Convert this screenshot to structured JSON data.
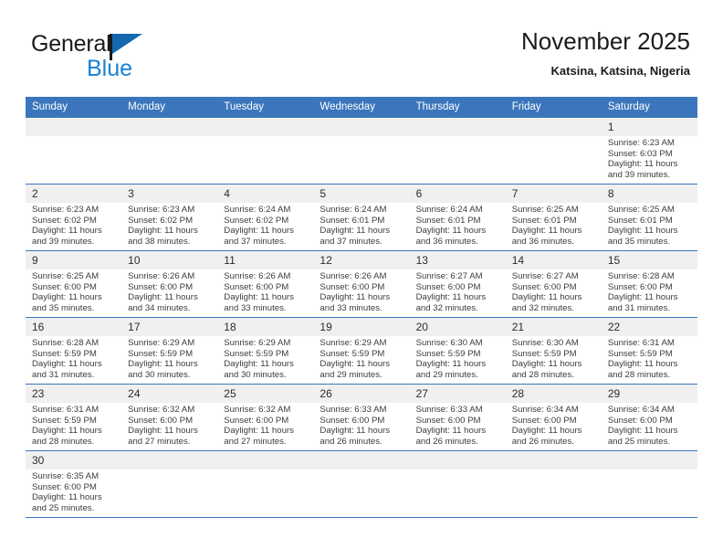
{
  "logo": {
    "text_primary": "General",
    "text_secondary": "Blue",
    "primary_color": "#1b1b1b",
    "secondary_color": "#1a7fd4",
    "flag_color": "#1567b0"
  },
  "header": {
    "title": "November 2025",
    "subtitle": "Katsina, Katsina, Nigeria"
  },
  "theme": {
    "header_bg": "#3b76bc",
    "header_text": "#ffffff",
    "daynum_bg": "#f0f0f0",
    "grid_line": "#3b76bc"
  },
  "calendar": {
    "weekday_headers": [
      "Sunday",
      "Monday",
      "Tuesday",
      "Wednesday",
      "Thursday",
      "Friday",
      "Saturday"
    ],
    "weeks": [
      [
        {
          "blank": true,
          "day": "",
          "sunrise": "",
          "sunset": "",
          "daylight": ""
        },
        {
          "blank": true,
          "day": "",
          "sunrise": "",
          "sunset": "",
          "daylight": ""
        },
        {
          "blank": true,
          "day": "",
          "sunrise": "",
          "sunset": "",
          "daylight": ""
        },
        {
          "blank": true,
          "day": "",
          "sunrise": "",
          "sunset": "",
          "daylight": ""
        },
        {
          "blank": true,
          "day": "",
          "sunrise": "",
          "sunset": "",
          "daylight": ""
        },
        {
          "blank": true,
          "day": "",
          "sunrise": "",
          "sunset": "",
          "daylight": ""
        },
        {
          "blank": false,
          "day": "1",
          "sunrise": "Sunrise: 6:23 AM",
          "sunset": "Sunset: 6:03 PM",
          "daylight": "Daylight: 11 hours and 39 minutes."
        }
      ],
      [
        {
          "blank": false,
          "day": "2",
          "sunrise": "Sunrise: 6:23 AM",
          "sunset": "Sunset: 6:02 PM",
          "daylight": "Daylight: 11 hours and 39 minutes."
        },
        {
          "blank": false,
          "day": "3",
          "sunrise": "Sunrise: 6:23 AM",
          "sunset": "Sunset: 6:02 PM",
          "daylight": "Daylight: 11 hours and 38 minutes."
        },
        {
          "blank": false,
          "day": "4",
          "sunrise": "Sunrise: 6:24 AM",
          "sunset": "Sunset: 6:02 PM",
          "daylight": "Daylight: 11 hours and 37 minutes."
        },
        {
          "blank": false,
          "day": "5",
          "sunrise": "Sunrise: 6:24 AM",
          "sunset": "Sunset: 6:01 PM",
          "daylight": "Daylight: 11 hours and 37 minutes."
        },
        {
          "blank": false,
          "day": "6",
          "sunrise": "Sunrise: 6:24 AM",
          "sunset": "Sunset: 6:01 PM",
          "daylight": "Daylight: 11 hours and 36 minutes."
        },
        {
          "blank": false,
          "day": "7",
          "sunrise": "Sunrise: 6:25 AM",
          "sunset": "Sunset: 6:01 PM",
          "daylight": "Daylight: 11 hours and 36 minutes."
        },
        {
          "blank": false,
          "day": "8",
          "sunrise": "Sunrise: 6:25 AM",
          "sunset": "Sunset: 6:01 PM",
          "daylight": "Daylight: 11 hours and 35 minutes."
        }
      ],
      [
        {
          "blank": false,
          "day": "9",
          "sunrise": "Sunrise: 6:25 AM",
          "sunset": "Sunset: 6:00 PM",
          "daylight": "Daylight: 11 hours and 35 minutes."
        },
        {
          "blank": false,
          "day": "10",
          "sunrise": "Sunrise: 6:26 AM",
          "sunset": "Sunset: 6:00 PM",
          "daylight": "Daylight: 11 hours and 34 minutes."
        },
        {
          "blank": false,
          "day": "11",
          "sunrise": "Sunrise: 6:26 AM",
          "sunset": "Sunset: 6:00 PM",
          "daylight": "Daylight: 11 hours and 33 minutes."
        },
        {
          "blank": false,
          "day": "12",
          "sunrise": "Sunrise: 6:26 AM",
          "sunset": "Sunset: 6:00 PM",
          "daylight": "Daylight: 11 hours and 33 minutes."
        },
        {
          "blank": false,
          "day": "13",
          "sunrise": "Sunrise: 6:27 AM",
          "sunset": "Sunset: 6:00 PM",
          "daylight": "Daylight: 11 hours and 32 minutes."
        },
        {
          "blank": false,
          "day": "14",
          "sunrise": "Sunrise: 6:27 AM",
          "sunset": "Sunset: 6:00 PM",
          "daylight": "Daylight: 11 hours and 32 minutes."
        },
        {
          "blank": false,
          "day": "15",
          "sunrise": "Sunrise: 6:28 AM",
          "sunset": "Sunset: 6:00 PM",
          "daylight": "Daylight: 11 hours and 31 minutes."
        }
      ],
      [
        {
          "blank": false,
          "day": "16",
          "sunrise": "Sunrise: 6:28 AM",
          "sunset": "Sunset: 5:59 PM",
          "daylight": "Daylight: 11 hours and 31 minutes."
        },
        {
          "blank": false,
          "day": "17",
          "sunrise": "Sunrise: 6:29 AM",
          "sunset": "Sunset: 5:59 PM",
          "daylight": "Daylight: 11 hours and 30 minutes."
        },
        {
          "blank": false,
          "day": "18",
          "sunrise": "Sunrise: 6:29 AM",
          "sunset": "Sunset: 5:59 PM",
          "daylight": "Daylight: 11 hours and 30 minutes."
        },
        {
          "blank": false,
          "day": "19",
          "sunrise": "Sunrise: 6:29 AM",
          "sunset": "Sunset: 5:59 PM",
          "daylight": "Daylight: 11 hours and 29 minutes."
        },
        {
          "blank": false,
          "day": "20",
          "sunrise": "Sunrise: 6:30 AM",
          "sunset": "Sunset: 5:59 PM",
          "daylight": "Daylight: 11 hours and 29 minutes."
        },
        {
          "blank": false,
          "day": "21",
          "sunrise": "Sunrise: 6:30 AM",
          "sunset": "Sunset: 5:59 PM",
          "daylight": "Daylight: 11 hours and 28 minutes."
        },
        {
          "blank": false,
          "day": "22",
          "sunrise": "Sunrise: 6:31 AM",
          "sunset": "Sunset: 5:59 PM",
          "daylight": "Daylight: 11 hours and 28 minutes."
        }
      ],
      [
        {
          "blank": false,
          "day": "23",
          "sunrise": "Sunrise: 6:31 AM",
          "sunset": "Sunset: 5:59 PM",
          "daylight": "Daylight: 11 hours and 28 minutes."
        },
        {
          "blank": false,
          "day": "24",
          "sunrise": "Sunrise: 6:32 AM",
          "sunset": "Sunset: 6:00 PM",
          "daylight": "Daylight: 11 hours and 27 minutes."
        },
        {
          "blank": false,
          "day": "25",
          "sunrise": "Sunrise: 6:32 AM",
          "sunset": "Sunset: 6:00 PM",
          "daylight": "Daylight: 11 hours and 27 minutes."
        },
        {
          "blank": false,
          "day": "26",
          "sunrise": "Sunrise: 6:33 AM",
          "sunset": "Sunset: 6:00 PM",
          "daylight": "Daylight: 11 hours and 26 minutes."
        },
        {
          "blank": false,
          "day": "27",
          "sunrise": "Sunrise: 6:33 AM",
          "sunset": "Sunset: 6:00 PM",
          "daylight": "Daylight: 11 hours and 26 minutes."
        },
        {
          "blank": false,
          "day": "28",
          "sunrise": "Sunrise: 6:34 AM",
          "sunset": "Sunset: 6:00 PM",
          "daylight": "Daylight: 11 hours and 26 minutes."
        },
        {
          "blank": false,
          "day": "29",
          "sunrise": "Sunrise: 6:34 AM",
          "sunset": "Sunset: 6:00 PM",
          "daylight": "Daylight: 11 hours and 25 minutes."
        }
      ],
      [
        {
          "blank": false,
          "day": "30",
          "sunrise": "Sunrise: 6:35 AM",
          "sunset": "Sunset: 6:00 PM",
          "daylight": "Daylight: 11 hours and 25 minutes."
        },
        {
          "blank": true,
          "day": "",
          "sunrise": "",
          "sunset": "",
          "daylight": ""
        },
        {
          "blank": true,
          "day": "",
          "sunrise": "",
          "sunset": "",
          "daylight": ""
        },
        {
          "blank": true,
          "day": "",
          "sunrise": "",
          "sunset": "",
          "daylight": ""
        },
        {
          "blank": true,
          "day": "",
          "sunrise": "",
          "sunset": "",
          "daylight": ""
        },
        {
          "blank": true,
          "day": "",
          "sunrise": "",
          "sunset": "",
          "daylight": ""
        },
        {
          "blank": true,
          "day": "",
          "sunrise": "",
          "sunset": "",
          "daylight": ""
        }
      ]
    ]
  }
}
